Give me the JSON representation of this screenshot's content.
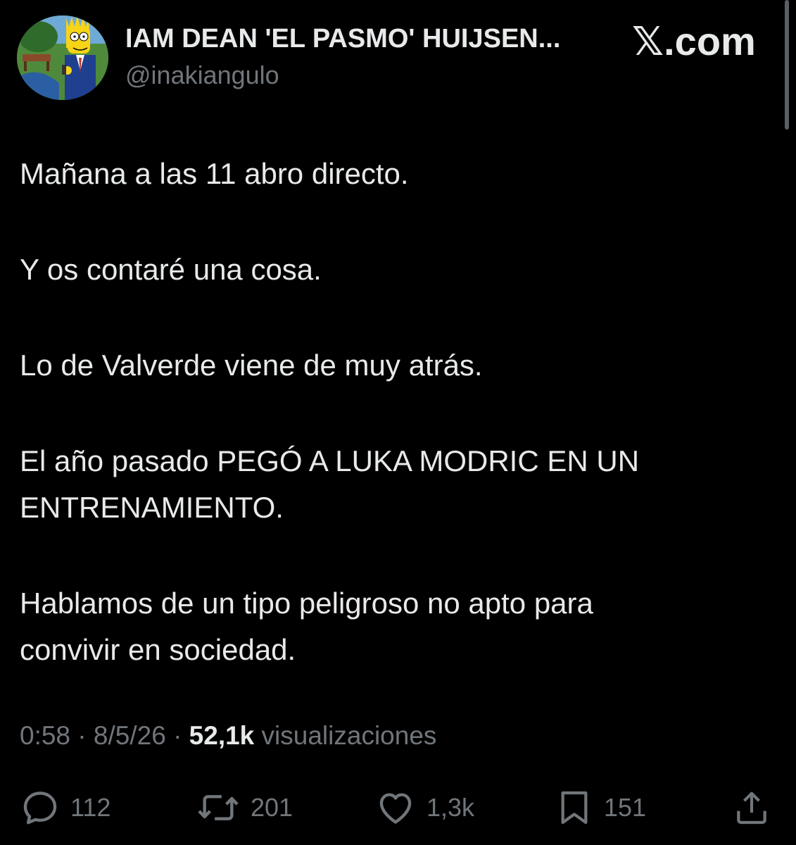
{
  "author": {
    "display_name": "IAM DEAN 'EL PASMO' HUIJSEN...",
    "handle": "@inakiangulo"
  },
  "site": {
    "label": ".com",
    "logo": "x-logo"
  },
  "tweet": {
    "paragraphs": [
      "Mañana a las 11 abro directo.",
      "Y os contaré una cosa.",
      "Lo de Valverde viene de muy atrás.",
      "El año pasado PEGÓ A LUKA MODRIC EN UN\nENTRENAMIENTO.",
      "Hablamos de un tipo peligroso no apto para\nconvivir en sociedad."
    ]
  },
  "meta": {
    "time": "0:58",
    "date": "8/5/26",
    "separator": "·",
    "views_count": "52,1k",
    "views_label": "visualizaciones"
  },
  "actions": {
    "replies": {
      "icon": "reply-icon",
      "count": "112"
    },
    "reposts": {
      "icon": "repost-icon",
      "count": "201"
    },
    "likes": {
      "icon": "heart-icon",
      "count": "1,3k"
    },
    "bookmarks": {
      "icon": "bookmark-icon",
      "count": "151"
    },
    "share": {
      "icon": "share-icon"
    }
  },
  "colors": {
    "background": "#000000",
    "text_primary": "#e7e9ea",
    "text_secondary": "#71767b"
  }
}
